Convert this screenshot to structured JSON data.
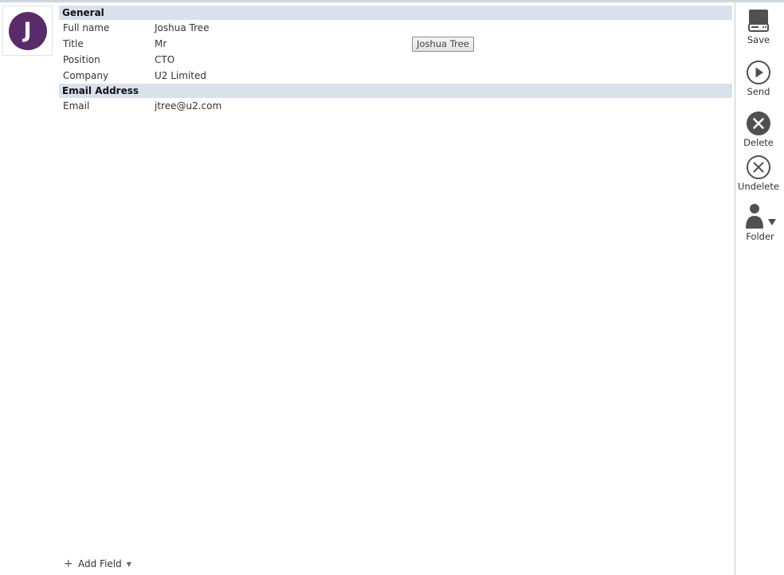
{
  "avatar": {
    "initial": "J",
    "color": "#5a2b6b"
  },
  "sections": {
    "general": {
      "title": "General",
      "rows": [
        {
          "label": "Full name",
          "value": "Joshua Tree"
        },
        {
          "label": "Title",
          "value": "Mr"
        },
        {
          "label": "Position",
          "value": "CTO"
        },
        {
          "label": "Company",
          "value": "U2 Limited"
        }
      ]
    },
    "email": {
      "title": "Email Address",
      "rows": [
        {
          "label": "Email",
          "value": "jtree@u2.com"
        }
      ]
    }
  },
  "tooltip": {
    "text": "Joshua Tree"
  },
  "toolbar": {
    "save": "Save",
    "send": "Send",
    "delete": "Delete",
    "undelete": "Undelete",
    "folder": "Folder"
  },
  "footer": {
    "add_field": "Add Field"
  },
  "colors": {
    "section_bg": "#d9e2ec",
    "icon": "#505050"
  }
}
